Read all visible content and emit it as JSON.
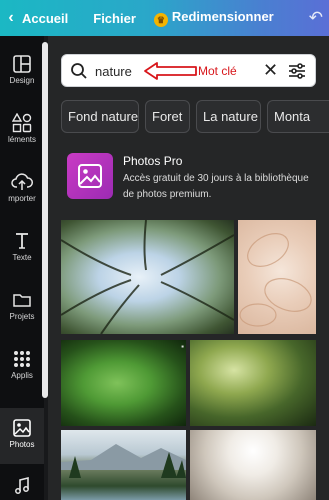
{
  "topbar": {
    "back_label": "Accueil",
    "file_label": "Fichier",
    "resize_label": "Redimensionner"
  },
  "sidebar": {
    "items": [
      {
        "label": "Design",
        "icon": "layout-icon"
      },
      {
        "label": "léments",
        "icon": "shapes-icon"
      },
      {
        "label": "mporter",
        "icon": "upload-cloud-icon"
      },
      {
        "label": "Texte",
        "icon": "text-icon"
      },
      {
        "label": "Projets",
        "icon": "folder-icon"
      },
      {
        "label": "Applis",
        "icon": "grid-dots-icon"
      },
      {
        "label": "Photos",
        "icon": "image-icon"
      }
    ]
  },
  "search": {
    "value": "nature",
    "annotation": "Mot clé",
    "annotation_color": "#d8161b"
  },
  "chips": [
    "Fond nature",
    "Foret",
    "La nature",
    "Monta"
  ],
  "promo": {
    "title": "Photos Pro",
    "description": "Accès gratuit de 30 jours à la bibliothèque de photos premium."
  },
  "colors": {
    "topbar_start": "#1bb8c4",
    "topbar_end": "#5a6fd6",
    "panel_bg": "#252627",
    "sidebar_bg": "#0e0f11",
    "promo_icon": "#c93bc4"
  }
}
